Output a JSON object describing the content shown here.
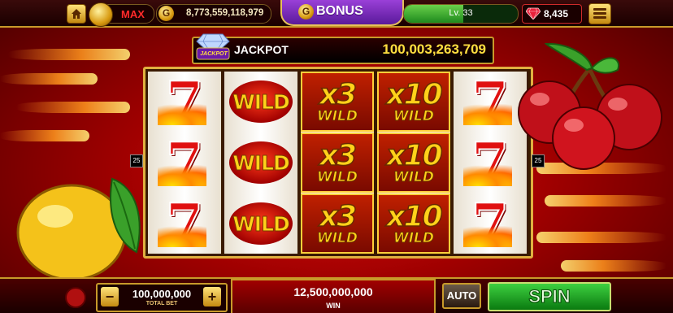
{
  "top_bar": {
    "home_icon": "home-icon",
    "max_label": "MAX",
    "balance": "8,773,559,118,979",
    "coin_symbol": "G",
    "bonus_label": "BONUS",
    "level_label": "Lv. 33",
    "level_progress": 0.52,
    "gems": "8,435",
    "menu_icon": "menu-icon"
  },
  "jackpot": {
    "badge_text": "JACKPOT",
    "label": "JACKPOT",
    "value": "100,003,263,709"
  },
  "reels": [
    [
      "7",
      "7",
      "7"
    ],
    [
      "WILD",
      "WILD",
      "WILD"
    ],
    [
      {
        "mult": "x3",
        "wild": "WILD"
      },
      {
        "mult": "x3",
        "wild": "WILD"
      },
      {
        "mult": "x3",
        "wild": "WILD"
      }
    ],
    [
      {
        "mult": "x10",
        "wild": "WILD"
      },
      {
        "mult": "x10",
        "wild": "WILD"
      },
      {
        "mult": "x10",
        "wild": "WILD"
      }
    ],
    [
      "7",
      "7",
      "7"
    ]
  ],
  "paylines": {
    "left": "25",
    "right": "25"
  },
  "bottom_bar": {
    "minus": "−",
    "plus": "+",
    "total_bet": "100,000,000",
    "total_bet_label": "TOTAL BET",
    "win": "12,500,000,000",
    "win_label": "WIN",
    "auto_label": "AUTO",
    "spin_label": "SPIN"
  },
  "colors": {
    "accent_gold": "#c89a2a",
    "background_red": "#a00000",
    "spin_green": "#1ea020"
  }
}
